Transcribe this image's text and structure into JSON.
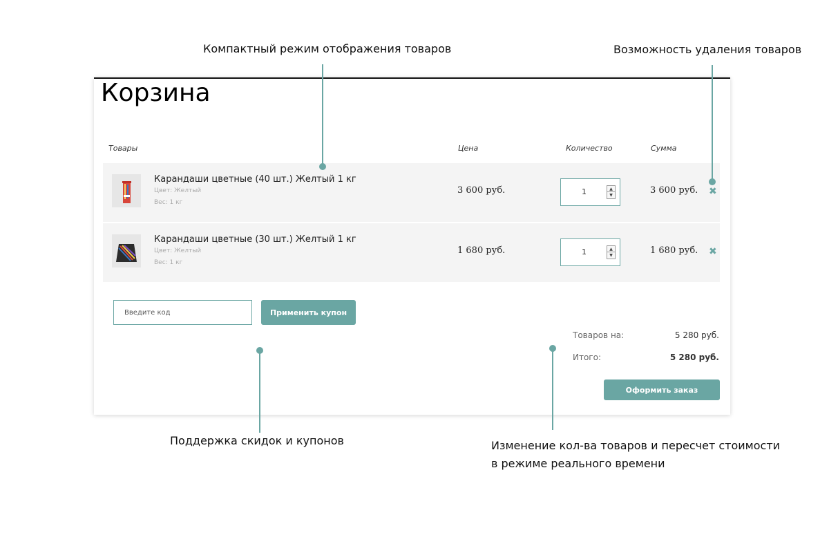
{
  "callouts": {
    "compact": "Компактный режим отображения товаров",
    "delete": "Возможность удаления товаров",
    "coupons": "Поддержка скидок и купонов",
    "realtime_line1": "Изменение кол-ва товаров и пересчет стоимости",
    "realtime_line2": "в режиме реального времени"
  },
  "cart": {
    "title": "Корзина",
    "columns": {
      "items": "Товары",
      "price": "Цена",
      "quantity": "Количество",
      "sum": "Сумма"
    },
    "items": [
      {
        "name": "Карандаши цветные (40 шт.) Желтый 1 кг",
        "color": "Цвет: Желтый",
        "weight": "Вес: 1 кг",
        "price": "3 600 руб.",
        "quantity": "1",
        "sum": "3 600 руб."
      },
      {
        "name": "Карандаши цветные (30 шт.) Желтый 1 кг",
        "color": "Цвет: Желтый",
        "weight": "Вес: 1 кг",
        "price": "1 680 руб.",
        "quantity": "1",
        "sum": "1 680 руб."
      }
    ],
    "coupon": {
      "placeholder": "Введите код",
      "button": "Применить купон"
    },
    "totals": {
      "goods_label": "Товаров на:",
      "goods_value": "5 280 руб.",
      "total_label": "Итого:",
      "total_value": "5 280 руб."
    },
    "checkout": "Оформить заказ"
  },
  "colors": {
    "accent": "#6aa6a3"
  },
  "icons": {
    "delete": "close-icon",
    "spin_up": "chevron-up-icon",
    "spin_down": "chevron-down-icon"
  }
}
